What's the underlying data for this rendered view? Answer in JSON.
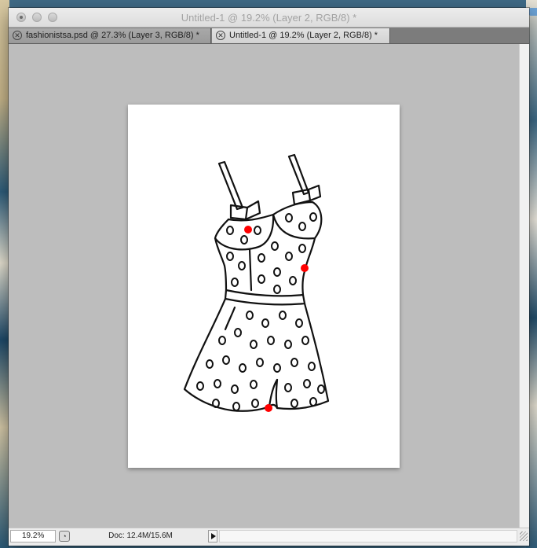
{
  "window": {
    "title": "Untitled-1 @ 19.2% (Layer 2, RGB/8) *"
  },
  "tabs": [
    {
      "label": "fashionistsa.psd @ 27.3% (Layer 3, RGB/8) *",
      "active": false
    },
    {
      "label": "Untitled-1 @ 19.2% (Layer 2, RGB/8) *",
      "active": true
    }
  ],
  "canvas": {
    "artwork": "polka-dot romper line drawing",
    "marker_color": "#ff0000",
    "marker_count": 3
  },
  "statusbar": {
    "zoom": "19.2%",
    "doc_info": "Doc: 12.4M/15.6M"
  },
  "colors": {
    "canvas_background": "#bdbdbd",
    "tab_bar": "#7c7c7c",
    "paper": "#ffffff"
  }
}
